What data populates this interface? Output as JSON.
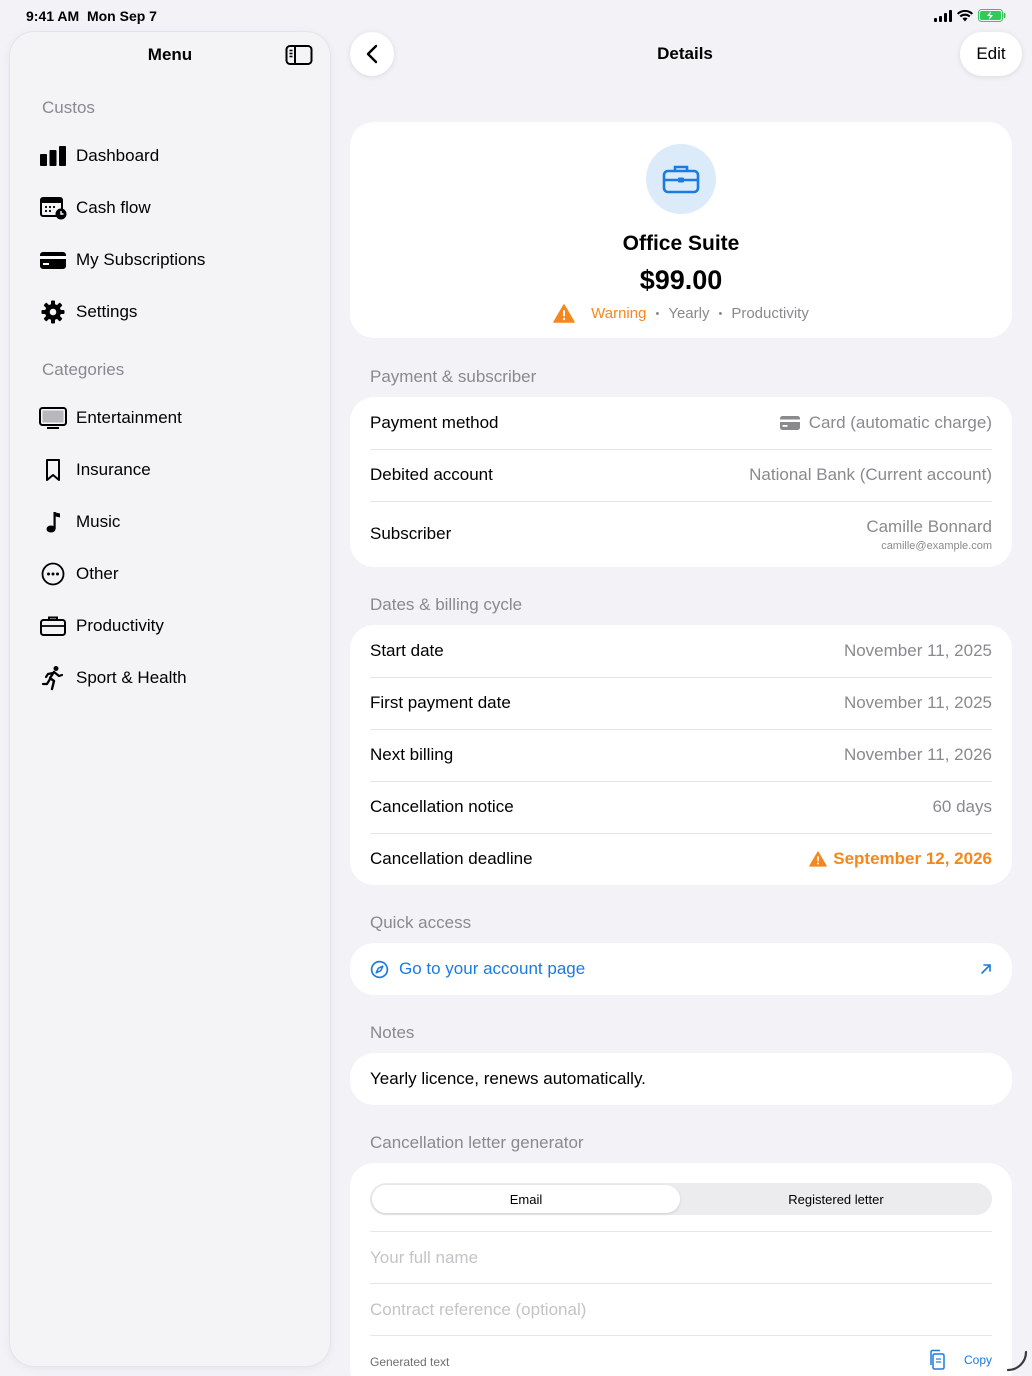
{
  "status": {
    "time": "9:41 AM",
    "date": "Mon Sep 7"
  },
  "sidebar": {
    "title": "Menu",
    "app_section": "Custos",
    "items": [
      {
        "label": "Dashboard",
        "icon": "chart-bar-icon"
      },
      {
        "label": "Cash flow",
        "icon": "calendar-clock-icon"
      },
      {
        "label": "My Subscriptions",
        "icon": "credit-card-icon"
      },
      {
        "label": "Settings",
        "icon": "gear-icon"
      }
    ],
    "categories_section": "Categories",
    "categories": [
      {
        "label": "Entertainment",
        "icon": "tv-icon"
      },
      {
        "label": "Insurance",
        "icon": "bookmark-icon"
      },
      {
        "label": "Music",
        "icon": "music-note-icon"
      },
      {
        "label": "Other",
        "icon": "ellipsis-circle-icon"
      },
      {
        "label": "Productivity",
        "icon": "briefcase-icon"
      },
      {
        "label": "Sport & Health",
        "icon": "running-figure-icon"
      }
    ]
  },
  "header": {
    "title": "Details",
    "edit_label": "Edit"
  },
  "subscription": {
    "name": "Office Suite",
    "price": "$99.00",
    "status": "Warning",
    "cycle": "Yearly",
    "category": "Productivity"
  },
  "payment": {
    "section": "Payment & subscriber",
    "method_label": "Payment method",
    "method_value": "Card (automatic charge)",
    "account_label": "Debited account",
    "account_value": "National Bank (Current account)",
    "subscriber_label": "Subscriber",
    "subscriber_name": "Camille Bonnard",
    "subscriber_email": "camille@example.com"
  },
  "dates": {
    "section": "Dates & billing cycle",
    "rows": [
      {
        "label": "Start date",
        "value": "November 11, 2025"
      },
      {
        "label": "First payment date",
        "value": "November 11, 2025"
      },
      {
        "label": "Next billing",
        "value": "November 11, 2026"
      },
      {
        "label": "Cancellation notice",
        "value": "60 days"
      }
    ],
    "deadline_label": "Cancellation deadline",
    "deadline_value": "September 12, 2026"
  },
  "quick_access": {
    "section": "Quick access",
    "link_label": "Go to your account page"
  },
  "notes": {
    "section": "Notes",
    "text": "Yearly licence, renews automatically."
  },
  "letter": {
    "section": "Cancellation letter generator",
    "tab_email": "Email",
    "tab_registered": "Registered letter",
    "name_placeholder": "Your full name",
    "reference_placeholder": "Contract reference (optional)",
    "generated_label": "Generated text",
    "copy_label": "Copy"
  },
  "colors": {
    "accent": "#1a7be0",
    "warning": "#f5871f",
    "background": "#f2f2f7"
  }
}
